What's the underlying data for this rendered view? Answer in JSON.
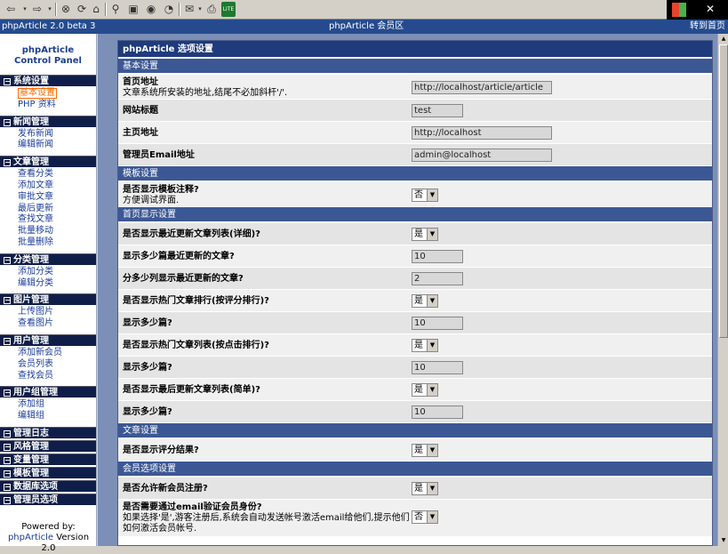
{
  "window": {
    "left_title": "phpArticle 2.0 beta 3",
    "center_title": "phpArticle 会员区",
    "right_link": "转到首页"
  },
  "toolbar": {
    "icons": [
      "back-icon",
      "forward-icon",
      "stop-icon",
      "refresh-icon",
      "home-icon",
      "search-icon",
      "favorites-icon",
      "media-icon",
      "history-icon",
      "mail-icon",
      "print-icon",
      "lite-icon"
    ]
  },
  "sidebar": {
    "title_line1": "phpArticle",
    "title_line2": "Control Panel",
    "sections": [
      {
        "label": "系统设置",
        "items": [
          "基本设置",
          "PHP 资料"
        ]
      },
      {
        "label": "新闻管理",
        "items": [
          "发布新闻",
          "编辑新闻"
        ]
      },
      {
        "label": "文章管理",
        "items": [
          "查看分类",
          "添加文章",
          "审批文章",
          "最后更新",
          "查找文章",
          "批量移动",
          "批量删除"
        ]
      },
      {
        "label": "分类管理",
        "items": [
          "添加分类",
          "编辑分类"
        ]
      },
      {
        "label": "图片管理",
        "items": [
          "上传图片",
          "查看图片"
        ]
      },
      {
        "label": "用户管理",
        "items": [
          "添加新会员",
          "会员列表",
          "查找会员"
        ]
      },
      {
        "label": "用户组管理",
        "items": [
          "添加组",
          "编辑组"
        ]
      },
      {
        "label": "管理日志",
        "items": []
      },
      {
        "label": "风格管理",
        "items": []
      },
      {
        "label": "变量管理",
        "items": []
      },
      {
        "label": "模板管理",
        "items": []
      },
      {
        "label": "数据库选项",
        "items": []
      },
      {
        "label": "管理员选项",
        "items": []
      }
    ],
    "powered_by": "Powered by:",
    "powered_link": "phpArticle",
    "powered_version": "Version 2.0"
  },
  "panel": {
    "title": "phpArticle 选项设置",
    "sections": [
      {
        "label": "基本设置",
        "rows": [
          {
            "label": "首页地址",
            "desc": "文章系统所安装的地址,结尾不必加斜杆'/'.",
            "type": "input",
            "value": "http://localhost/article/article"
          },
          {
            "label": "网站标题",
            "desc": "",
            "type": "input",
            "value": "test"
          },
          {
            "label": "主页地址",
            "desc": "",
            "type": "input",
            "value": "http://localhost"
          },
          {
            "label": "管理员Email地址",
            "desc": "",
            "type": "input",
            "value": "admin@localhost"
          }
        ]
      },
      {
        "label": "模板设置",
        "rows": [
          {
            "label": "是否显示模板注释?",
            "desc": "方便调试界面.",
            "type": "select",
            "value": "否"
          }
        ]
      },
      {
        "label": "首页显示设置",
        "rows": [
          {
            "label": "是否显示最近更新文章列表(详细)?",
            "desc": "",
            "type": "select",
            "value": "是"
          },
          {
            "label": "显示多少篇最近更新的文章?",
            "desc": "",
            "type": "input",
            "value": "10"
          },
          {
            "label": "分多少列显示最近更新的文章?",
            "desc": "",
            "type": "input",
            "value": "2"
          },
          {
            "label": "是否显示热门文章排行(按评分排行)?",
            "desc": "",
            "type": "select",
            "value": "是"
          },
          {
            "label": "显示多少篇?",
            "desc": "",
            "type": "input",
            "value": "10"
          },
          {
            "label": "是否显示热门文章列表(按点击排行)?",
            "desc": "",
            "type": "select",
            "value": "是"
          },
          {
            "label": "显示多少篇?",
            "desc": "",
            "type": "input",
            "value": "10"
          },
          {
            "label": "是否显示最后更新文章列表(简单)?",
            "desc": "",
            "type": "select",
            "value": "是"
          },
          {
            "label": "显示多少篇?",
            "desc": "",
            "type": "input",
            "value": "10"
          }
        ]
      },
      {
        "label": "文章设置",
        "rows": [
          {
            "label": "是否显示评分结果?",
            "desc": "",
            "type": "select",
            "value": "是"
          }
        ]
      },
      {
        "label": "会员选项设置",
        "rows": [
          {
            "label": "是否允许新会员注册?",
            "desc": "",
            "type": "select",
            "value": "是"
          },
          {
            "label": "是否需要通过email验证会员身份?",
            "desc": "如果选择'是',游客注册后,系统会自动发送帐号激活email给他们,提示他们如何激活会员帐号.",
            "type": "select",
            "value": "否"
          }
        ]
      }
    ]
  }
}
